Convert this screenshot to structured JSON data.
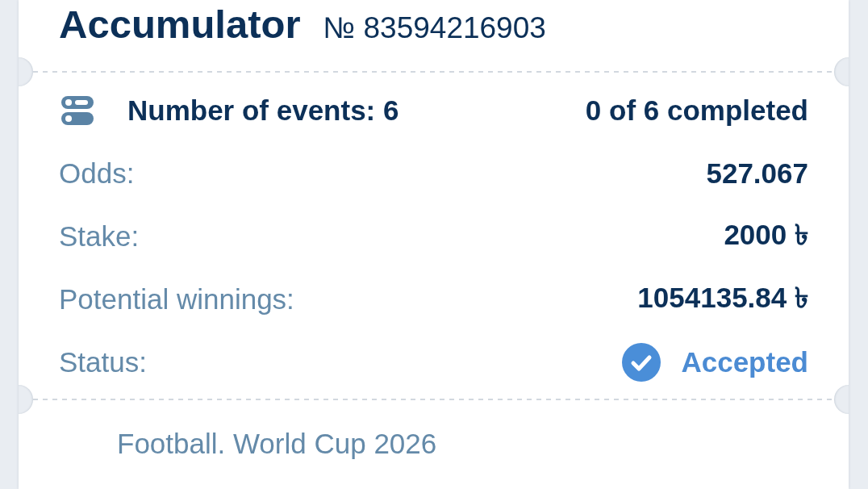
{
  "bet": {
    "type": "Accumulator",
    "number": "№ 83594216903"
  },
  "summary": {
    "events": "Number of events: 6",
    "progress": "0 of 6 completed"
  },
  "details": [
    {
      "label": "Odds:",
      "value": "527.067",
      "kind": "value"
    },
    {
      "label": "Stake:",
      "value": "2000 ৳",
      "kind": "value"
    },
    {
      "label": "Potential winnings:",
      "value": "1054135.84 ৳",
      "kind": "value"
    },
    {
      "label": "Status:",
      "value": "Accepted",
      "kind": "status"
    }
  ],
  "events": [
    {
      "title": "Football. World Cup 2026"
    }
  ]
}
